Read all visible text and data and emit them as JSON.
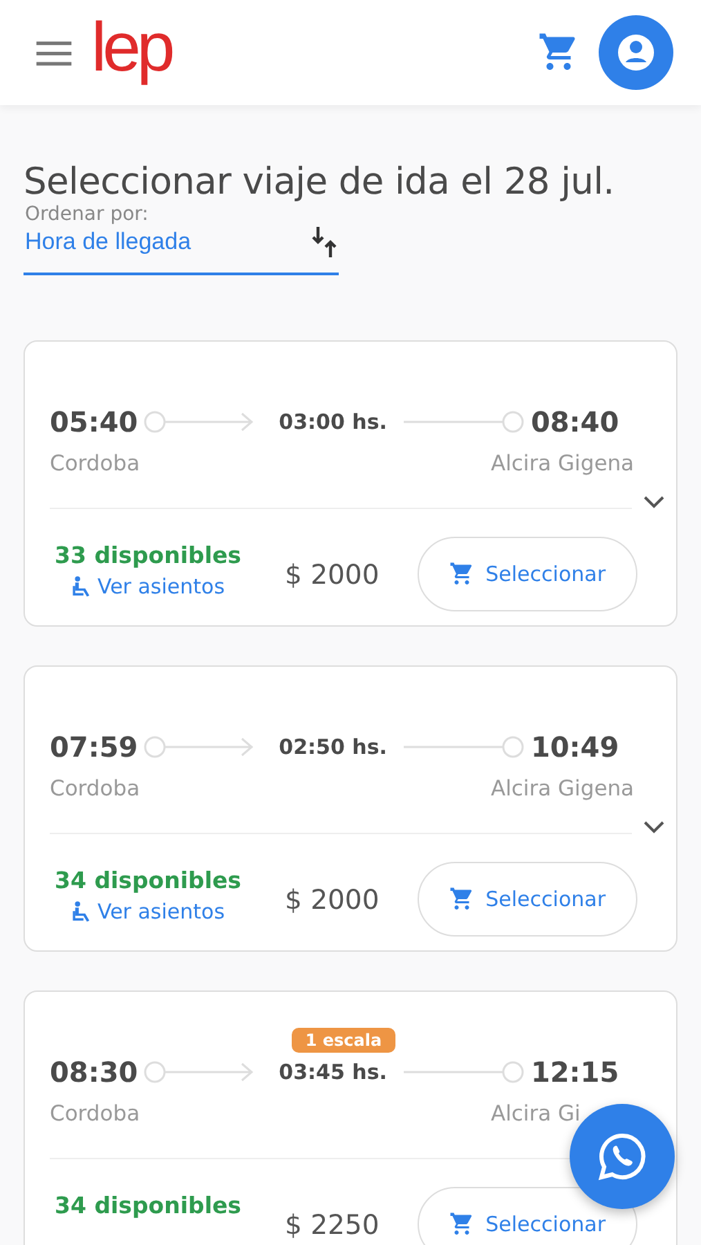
{
  "header": {
    "logo": "lep"
  },
  "title": "Seleccionar viaje de ida el 28 jul.",
  "sort": {
    "label": "Ordenar por:",
    "value": "Hora de llegada"
  },
  "trips": [
    {
      "depart": "05:40",
      "duration": "03:00 hs.",
      "arrive": "08:40",
      "origin": "Cordoba",
      "destination": "Alcira Gigena",
      "expandable": true,
      "available": "33 disponibles",
      "seats_link": "Ver asientos",
      "price": "$ 2000",
      "button": "Seleccionar"
    },
    {
      "depart": "07:59",
      "duration": "02:50 hs.",
      "arrive": "10:49",
      "origin": "Cordoba",
      "destination": "Alcira Gigena",
      "expandable": true,
      "available": "34 disponibles",
      "seats_link": "Ver asientos",
      "price": "$ 2000",
      "button": "Seleccionar"
    },
    {
      "stops": "1 escala",
      "depart": "08:30",
      "duration": "03:45 hs.",
      "arrive": "12:15",
      "origin": "Cordoba",
      "destination": "Alcira Gi",
      "available": "34 disponibles",
      "price": "$ 2250",
      "button": "Seleccionar"
    }
  ]
}
